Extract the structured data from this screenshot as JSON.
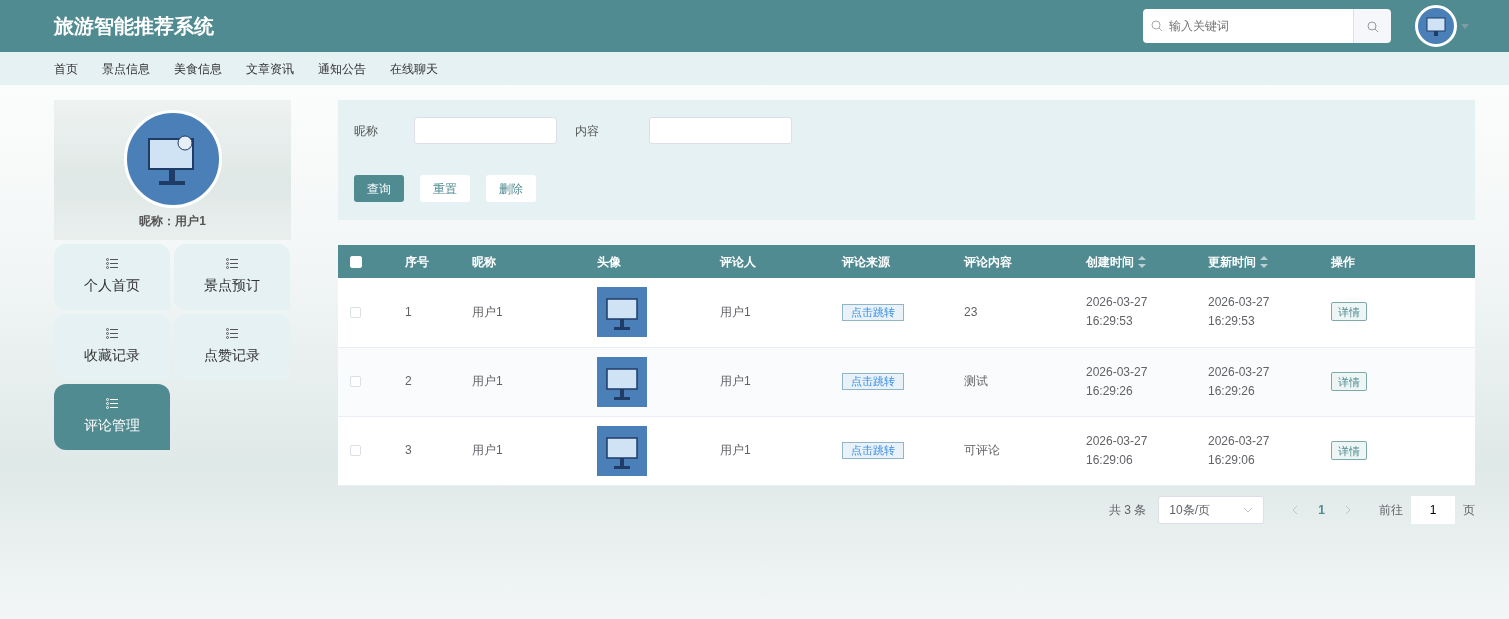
{
  "header": {
    "title": "旅游智能推荐系统",
    "search": {
      "placeholder": "输入关键词"
    }
  },
  "nav": [
    {
      "label": "首页"
    },
    {
      "label": "景点信息"
    },
    {
      "label": "美食信息"
    },
    {
      "label": "文章资讯"
    },
    {
      "label": "通知公告"
    },
    {
      "label": "在线聊天"
    }
  ],
  "profile": {
    "nickname": "昵称：用户1"
  },
  "sidebar": {
    "items": [
      {
        "label": "个人首页",
        "selected": false
      },
      {
        "label": "景点预订",
        "selected": false
      },
      {
        "label": "收藏记录",
        "selected": false
      },
      {
        "label": "点赞记录",
        "selected": false
      },
      {
        "label": "评论管理",
        "selected": true
      }
    ]
  },
  "filters": [
    {
      "label": "昵称"
    },
    {
      "label": "内容"
    }
  ],
  "buttons": [
    {
      "label": "查询",
      "kind": "primary"
    },
    {
      "label": "重置",
      "kind": "plain"
    },
    {
      "label": "删除",
      "kind": "plain"
    }
  ],
  "table": {
    "select_all": {
      "checked": false
    },
    "columns": [
      {
        "label": "序号",
        "sortable": false
      },
      {
        "label": "昵称",
        "sortable": false
      },
      {
        "label": "头像",
        "sortable": false
      },
      {
        "label": "评论人",
        "sortable": false
      },
      {
        "label": "评论来源",
        "sortable": false
      },
      {
        "label": "评论内容",
        "sortable": false
      },
      {
        "label": "创建时间",
        "sortable": true
      },
      {
        "label": "更新时间",
        "sortable": true
      },
      {
        "label": "操作",
        "sortable": false
      }
    ],
    "rows": [
      {
        "checked": false,
        "index": "1",
        "nickname": "用户1",
        "commenter": "用户1",
        "source": "点击跳转",
        "content": "23",
        "created": "2026-03-27 16:29:53",
        "updated": "2026-03-27 16:29:53",
        "action": "详情"
      },
      {
        "checked": false,
        "index": "2",
        "nickname": "用户1",
        "commenter": "用户1",
        "source": "点击跳转",
        "content": "测试",
        "created": "2026-03-27 16:29:26",
        "updated": "2026-03-27 16:29:26",
        "action": "详情"
      },
      {
        "checked": false,
        "index": "3",
        "nickname": "用户1",
        "commenter": "用户1",
        "source": "点击跳转",
        "content": "可评论",
        "created": "2026-03-27 16:29:06",
        "updated": "2026-03-27 16:29:06",
        "action": "详情"
      }
    ]
  },
  "pagination": {
    "total": "共 3 条",
    "page_size": "10条/页",
    "pages": [
      {
        "label": "1",
        "selected": true
      }
    ],
    "goto_label": "前往",
    "goto_value": "1",
    "goto_suffix": "页"
  }
}
